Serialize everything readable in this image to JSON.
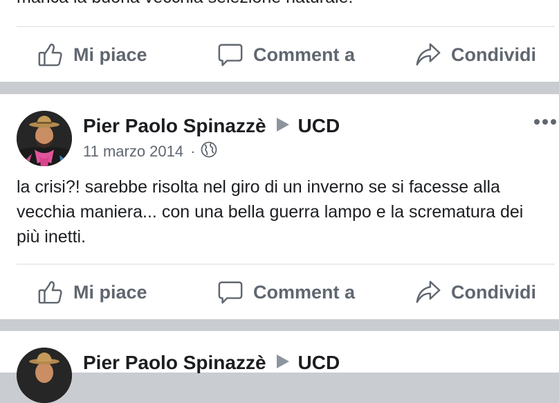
{
  "previous_post": {
    "text_tail": "manca la buona vecchia selezione naturale!"
  },
  "actions": {
    "like_label": "Mi piace",
    "comment_label": "Comment a",
    "share_label": "Condividi"
  },
  "post": {
    "author": "Pier Paolo Spinazzè",
    "group": "UCD",
    "date": "11 marzo 2014",
    "separator": "·",
    "privacy_icon": "globe-icon",
    "text": "la crisi?! sarebbe risolta nel giro di un inverno se si facesse alla vecchia maniera... con una bella guerra lampo e la scrematura dei più inetti."
  },
  "next_post": {
    "author": "Pier Paolo Spinazzè",
    "group": "UCD"
  },
  "colors": {
    "background": "#c9ccd1",
    "card": "#ffffff",
    "text": "#1c1e21",
    "secondary": "#606770",
    "divider": "#dadde1"
  }
}
